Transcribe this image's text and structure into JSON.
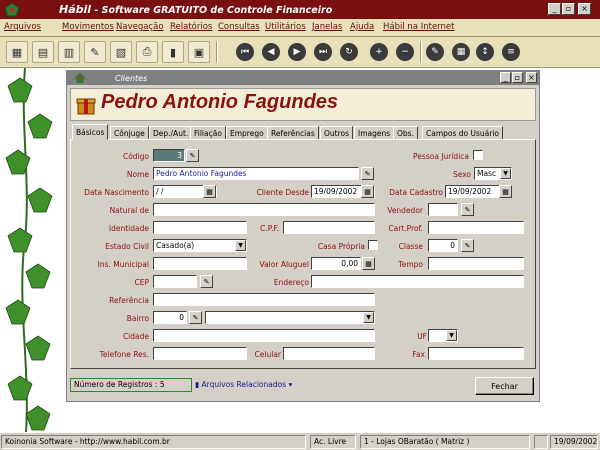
{
  "app": {
    "logo_text": "Hábil",
    "title_suffix": " - Software GRATUITO de Controle Financeiro"
  },
  "menu": [
    "Arquivos",
    "Movimentos",
    "Navegação",
    "Relatórios",
    "Consultas",
    "Utilitários",
    "Janelas",
    "Ajuda",
    "Hábil na Internet"
  ],
  "window": {
    "title": "Clientes",
    "client_name": "Pedro Antonio Fagundes"
  },
  "tabs": [
    "Básicos",
    "Cônjuge",
    "Dep./Aut.",
    "Filiação",
    "Emprego",
    "Referências",
    "Outros",
    "Imagens",
    "Obs.",
    "Campos do Usuário"
  ],
  "form": {
    "codigo_label": "Código",
    "codigo_value": "3",
    "pessoa_juridica_label": "Pessoa Jurídica",
    "nome_label": "Nome",
    "nome_value": "Pedro Antonio Fagundes",
    "sexo_label": "Sexo",
    "sexo_value": "Masc",
    "data_nascimento_label": "Data Nascimento",
    "data_nascimento_value": " / /",
    "cliente_desde_label": "Cliente Desde",
    "cliente_desde_value": "19/09/2002",
    "data_cadastro_label": "Data Cadastro",
    "data_cadastro_value": "19/09/2002",
    "natural_label": "Natural de",
    "vendedor_label": "Vendedor",
    "identidade_label": "Identidade",
    "cpf_label": "C.P.F.",
    "cart_prof_label": "Cart.Prof.",
    "estado_civil_label": "Estado Civil",
    "estado_civil_value": "Casado(a)",
    "casa_propria_label": "Casa Própria",
    "classe_label": "Classe",
    "classe_value": "0",
    "ins_municipal_label": "Ins. Municipal",
    "valor_aluguel_label": "Valor Aluguel",
    "valor_aluguel_value": "0,00",
    "tempo_label": "Tempo",
    "cep_label": "CEP",
    "endereco_label": "Endereço",
    "referencia_label": "Referência",
    "bairro_label": "Bairro",
    "bairro_value": "0",
    "cidade_label": "Cidade",
    "uf_label": "UF",
    "telefone_label": "Telefone Res.",
    "celular_label": "Celular",
    "fax_label": "Fax"
  },
  "footer": {
    "registros": "Número de Registros : 5",
    "arquivos": "Arquivos Relacionados",
    "fechar": "Fechar"
  },
  "status": {
    "company": "Koinonia Software - http://www.habil.com.br",
    "mode": "Ac. Livre",
    "store": "1 - Lojas OBaratão ( Matriz )",
    "date": "19/09/2002"
  },
  "colors": {
    "titlebar": "#7a0f10",
    "menubar": "#e8e0b8",
    "client_name": "#8b1010",
    "window_face": "#d4d0c8"
  }
}
